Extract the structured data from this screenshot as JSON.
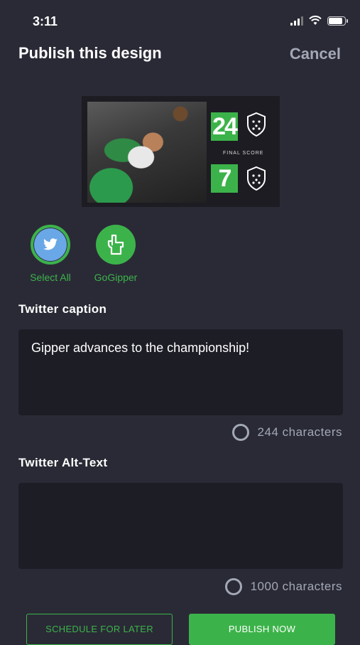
{
  "status_bar": {
    "time": "3:11"
  },
  "header": {
    "title": "Publish this design",
    "cancel_label": "Cancel"
  },
  "preview": {
    "score_top": "24",
    "score_bottom": "7",
    "final_score_label": "FINAL SCORE"
  },
  "channels": [
    {
      "label": "Select All",
      "icon": "twitter-bird-icon",
      "color": "#6aa7e6"
    },
    {
      "label": "GoGipper",
      "icon": "gogipper-foam-finger-icon",
      "color": "#3cb34a"
    }
  ],
  "caption": {
    "label": "Twitter caption",
    "value": "Gipper advances to the championship!",
    "counter": "244 characters"
  },
  "alt_text": {
    "label": "Twitter Alt-Text",
    "value": "",
    "counter": "1000 characters"
  },
  "buttons": {
    "schedule_label": "SCHEDULE FOR LATER",
    "publish_label": "PUBLISH NOW"
  },
  "colors": {
    "background": "#2a2a36",
    "accent_green": "#3cb34a",
    "muted_text": "#a3a8b6",
    "field_background": "#1d1d26"
  }
}
